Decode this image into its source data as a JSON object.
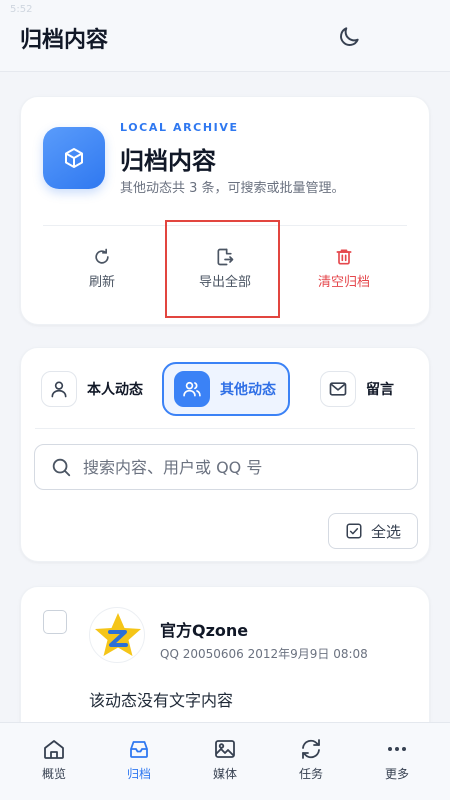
{
  "status_bar": {
    "time": "5:52"
  },
  "header": {
    "title": "归档内容"
  },
  "summary": {
    "eyebrow": "LOCAL ARCHIVE",
    "title": "归档内容",
    "subtitle": "其他动态共 3 条，可搜索或批量管理。",
    "actions": [
      {
        "label": "刷新",
        "icon": "refresh-icon"
      },
      {
        "label": "导出全部",
        "icon": "export-icon"
      },
      {
        "label": "清空归档",
        "icon": "trash-icon"
      }
    ]
  },
  "filters": {
    "tabs": [
      {
        "label": "本人动态",
        "icon": "person-icon",
        "selected": false
      },
      {
        "label": "其他动态",
        "icon": "people-icon",
        "selected": true
      },
      {
        "label": "留言",
        "icon": "mail-icon",
        "selected": false
      }
    ],
    "search_placeholder": "搜索内容、用户或 QQ 号",
    "select_all": "全选"
  },
  "posts": [
    {
      "name": "官方Qzone",
      "meta": "QQ 20050606 2012年9月9日 08:08",
      "text": "该动态没有文字内容"
    }
  ],
  "bottom_nav": [
    {
      "label": "概览",
      "icon": "home-icon"
    },
    {
      "label": "归档",
      "icon": "archive-icon",
      "active": true
    },
    {
      "label": "媒体",
      "icon": "image-icon"
    },
    {
      "label": "任务",
      "icon": "sync-icon"
    },
    {
      "label": "更多",
      "icon": "more-icon"
    }
  ],
  "colors": {
    "accent": "#2f78f0",
    "danger": "#e5484d",
    "highlight_box": "#e2453f"
  }
}
